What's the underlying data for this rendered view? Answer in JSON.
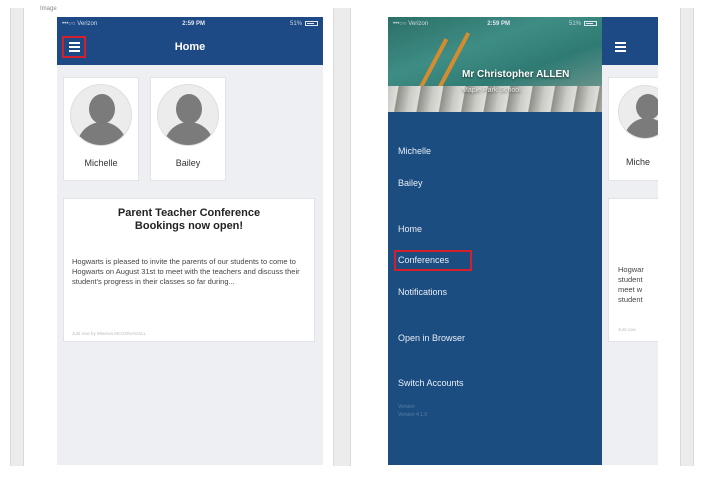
{
  "corner_label": "Image",
  "left_screen": {
    "status": {
      "carrier": "•••○○ Verizon",
      "time": "2:59 PM",
      "battery": "51%"
    },
    "title": "Home",
    "menu_icon": "hamburger-menu-icon",
    "students": [
      {
        "name": "Michelle",
        "icon": "person-silhouette-icon"
      },
      {
        "name": "Bailey",
        "icon": "person-silhouette-icon"
      }
    ],
    "announcement": {
      "title": "Parent Teacher Conference Bookings now open!",
      "body": "Hogwarts is pleased to invite the parents of our students to come to Hogwarts on August 31st to meet with the teachers and discuss their student's progress in their classes so far during...",
      "meta": "Just now by Minerva MCGONAGALL"
    }
  },
  "right_screen": {
    "status": {
      "carrier": "•••○○ Verizon",
      "time": "2:59 PM",
      "battery": "51%"
    },
    "user_name": "Mr Christopher ALLEN",
    "school_name": "Maple Park School",
    "menu": {
      "students": [
        "Michelle",
        "Bailey"
      ],
      "home": "Home",
      "conferences": "Conferences",
      "notifications": "Notifications",
      "open_browser": "Open in Browser",
      "switch_accounts": "Switch Accounts"
    },
    "footer": [
      "Version",
      "Version 4.1.0"
    ],
    "background_peek": {
      "student_name": "Miche",
      "announcement_lines": [
        "Hogwar",
        "student",
        "meet w",
        "student"
      ],
      "meta": "Just now"
    }
  },
  "colors": {
    "navbar": "#1d4a85",
    "drawer": "#1b4d80",
    "highlight": "#d3202c",
    "page_bg": "#eeeff2"
  }
}
